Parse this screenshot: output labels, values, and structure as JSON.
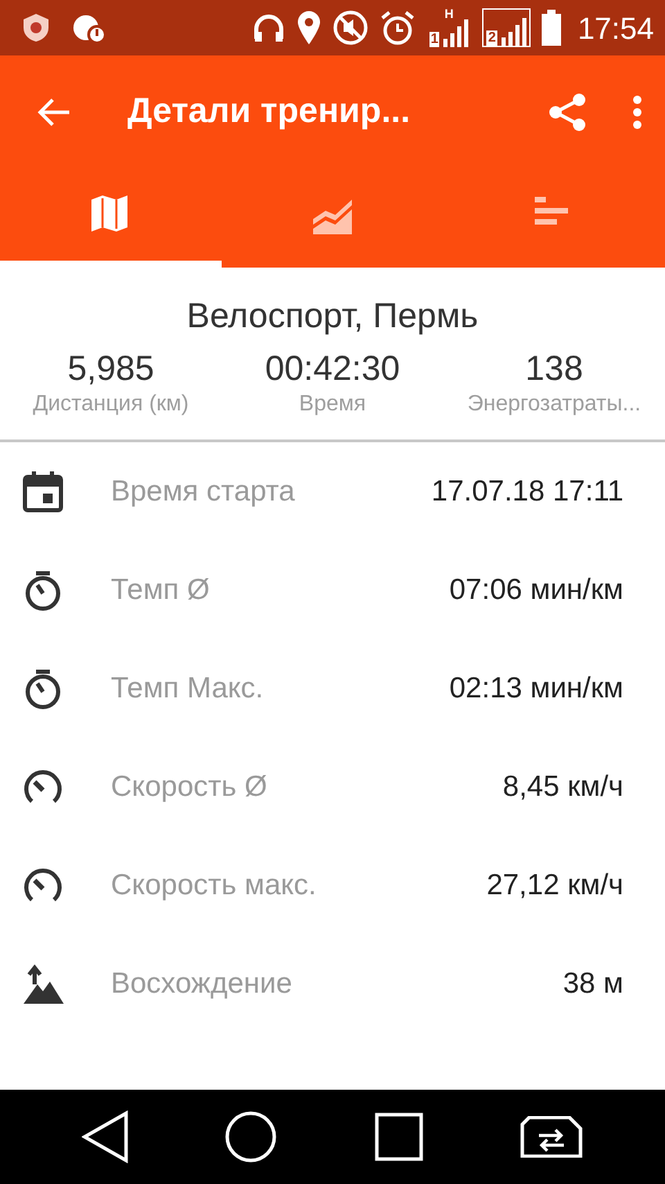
{
  "status_bar": {
    "time": "17:54",
    "sim1_label": "1",
    "sim2_label": "2",
    "sim1_network": "H"
  },
  "toolbar": {
    "title": "Детали тренир..."
  },
  "tabs": [
    {
      "kind": "map",
      "selected": true
    },
    {
      "kind": "chart",
      "selected": false
    },
    {
      "kind": "bars",
      "selected": false
    }
  ],
  "summary": {
    "title": "Велоспорт, Пермь",
    "stats": [
      {
        "value": "5,985",
        "label": "Дистанция (км)"
      },
      {
        "value": "00:42:30",
        "label": "Время"
      },
      {
        "value": "138",
        "label": "Энергозатраты..."
      }
    ]
  },
  "details": [
    {
      "kind": "calendar",
      "label": "Время старта",
      "value": "17.07.18 17:11"
    },
    {
      "kind": "stopwatch",
      "label": "Темп Ø",
      "value": "07:06 мин/км"
    },
    {
      "kind": "stopwatch",
      "label": "Темп Макс.",
      "value": "02:13 мин/км"
    },
    {
      "kind": "speedometer",
      "label": "Скорость Ø",
      "value": "8,45 км/ч"
    },
    {
      "kind": "speedometer",
      "label": "Скорость макс.",
      "value": "27,12 км/ч"
    },
    {
      "kind": "ascent",
      "label": "Восхождение",
      "value": "38 м"
    }
  ]
}
